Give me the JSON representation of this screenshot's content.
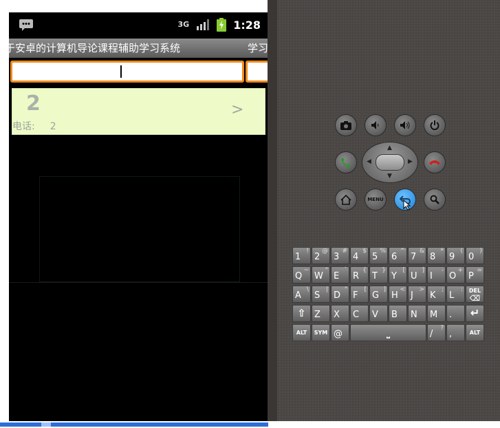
{
  "status_bar": {
    "network": "3G",
    "time": "1:28",
    "icons": [
      "message-icon",
      "signal-icon",
      "battery-icon"
    ]
  },
  "app": {
    "title": "于安卓的计算机导论课程辅助学习系统",
    "title_right": "学习"
  },
  "search": {
    "value": "",
    "placeholder": ""
  },
  "list": [
    {
      "number": "2",
      "phone_label": "电话:",
      "phone_value": "2",
      "arrow": ">"
    }
  ],
  "controls": {
    "buttons": [
      {
        "name": "camera-icon",
        "glyph": "📷"
      },
      {
        "name": "volume-down-icon",
        "glyph": "🔉"
      },
      {
        "name": "volume-up-icon",
        "glyph": "🔊"
      },
      {
        "name": "power-icon",
        "glyph": "⏻"
      },
      {
        "name": "call-icon",
        "glyph": "📞"
      },
      {
        "name": "end-call-icon",
        "glyph": "☎"
      },
      {
        "name": "home-icon",
        "glyph": "⌂"
      },
      {
        "name": "menu-icon",
        "glyph": "MENU"
      },
      {
        "name": "back-icon",
        "glyph": "↩"
      },
      {
        "name": "search-icon",
        "glyph": "🔍"
      }
    ]
  },
  "keyboard": {
    "row1": [
      [
        "1",
        "!"
      ],
      [
        "2",
        "@"
      ],
      [
        "3",
        "#"
      ],
      [
        "4",
        "$"
      ],
      [
        "5",
        "%"
      ],
      [
        "6",
        "^"
      ],
      [
        "7",
        "&"
      ],
      [
        "8",
        "*"
      ],
      [
        "9",
        "("
      ],
      [
        "0",
        ")"
      ]
    ],
    "row2": [
      [
        "Q",
        "~"
      ],
      [
        "W",
        "\""
      ],
      [
        "E",
        "`"
      ],
      [
        "R",
        "{"
      ],
      [
        "T",
        "}"
      ],
      [
        "Y",
        "["
      ],
      [
        "U",
        "]"
      ],
      [
        "I",
        "-"
      ],
      [
        "O",
        "+"
      ],
      [
        "P",
        "="
      ]
    ],
    "row3": [
      [
        "A",
        "\\"
      ],
      [
        "S",
        "|"
      ],
      [
        "D",
        "\""
      ],
      [
        "F",
        "["
      ],
      [
        "G",
        "]"
      ],
      [
        "H",
        "<"
      ],
      [
        "J",
        ">"
      ],
      [
        "K",
        ";"
      ],
      [
        "L",
        ":"
      ],
      [
        "DEL",
        ""
      ]
    ],
    "row4": [
      [
        "⇧",
        ""
      ],
      [
        "Z",
        ""
      ],
      [
        "X",
        ""
      ],
      [
        "C",
        ""
      ],
      [
        "V",
        ""
      ],
      [
        "B",
        ""
      ],
      [
        "N",
        ""
      ],
      [
        "M",
        ""
      ],
      [
        ".",
        ""
      ],
      [
        "↵",
        ""
      ]
    ],
    "row5": {
      "alt": "ALT",
      "sym": "SYM",
      "at": "@",
      "space": "⎵",
      "slash": "/",
      "question": "?",
      "comma": ",",
      "alt2": "ALT"
    }
  },
  "colors": {
    "accent": "#f08a1c",
    "list_bg": "#eefbc9",
    "panel_bg": "#4a4644"
  }
}
